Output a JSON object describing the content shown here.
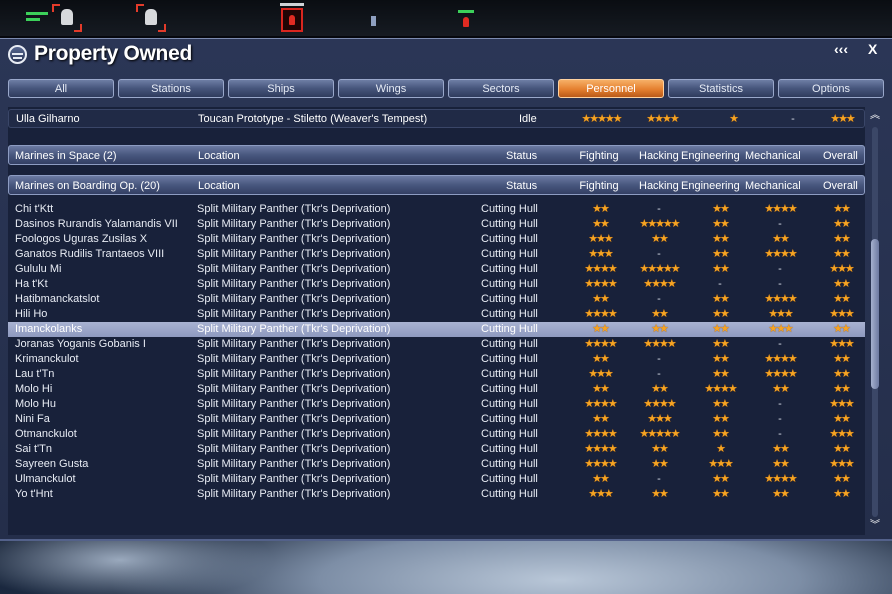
{
  "window": {
    "title": "Property Owned",
    "controls": {
      "collapse": "‹‹‹",
      "close": "X"
    }
  },
  "tabs": [
    {
      "label": "All",
      "active": false
    },
    {
      "label": "Stations",
      "active": false
    },
    {
      "label": "Ships",
      "active": false
    },
    {
      "label": "Wings",
      "active": false
    },
    {
      "label": "Sectors",
      "active": false
    },
    {
      "label": "Personnel",
      "active": true
    },
    {
      "label": "Statistics",
      "active": false
    },
    {
      "label": "Options",
      "active": false
    }
  ],
  "top_entry": {
    "name": "Ulla Gilharno",
    "location": "Toucan Prototype - Stiletto (Weaver's Tempest)",
    "status": "Idle",
    "fighting": "★★★★★",
    "hacking": "★★★★",
    "engineering": "★",
    "mechanical": "-",
    "overall": "★★★"
  },
  "groups": {
    "space": {
      "label": "Marines in Space (2)",
      "col_location": "Location",
      "col_status": "Status",
      "col_fighting": "Fighting",
      "col_hacking": "Hacking",
      "col_engineering": "Engineering",
      "col_mechanical": "Mechanical",
      "col_overall": "Overall"
    },
    "boarding": {
      "label": "Marines on Boarding Op. (20)",
      "col_location": "Location",
      "col_status": "Status",
      "col_fighting": "Fighting",
      "col_hacking": "Hacking",
      "col_engineering": "Engineering",
      "col_mechanical": "Mechanical",
      "col_overall": "Overall"
    }
  },
  "marines": [
    {
      "name": "Chi t'Ktt",
      "location": "Split Military Panther (Tkr's Deprivation)",
      "status": "Cutting Hull",
      "fighting": "★★",
      "hacking": "-",
      "engineering": "★★",
      "mechanical": "★★★★",
      "overall": "★★"
    },
    {
      "name": "Dasinos Rurandis Yalamandis VII",
      "location": "Split Military Panther (Tkr's Deprivation)",
      "status": "Cutting Hull",
      "fighting": "★★",
      "hacking": "★★★★★",
      "engineering": "★★",
      "mechanical": "-",
      "overall": "★★"
    },
    {
      "name": "Foologos Uguras Zusilas X",
      "location": "Split Military Panther (Tkr's Deprivation)",
      "status": "Cutting Hull",
      "fighting": "★★★",
      "hacking": "★★",
      "engineering": "★★",
      "mechanical": "★★",
      "overall": "★★"
    },
    {
      "name": "Ganatos Rudilis Trantaeos VIII",
      "location": "Split Military Panther (Tkr's Deprivation)",
      "status": "Cutting Hull",
      "fighting": "★★★",
      "hacking": "-",
      "engineering": "★★",
      "mechanical": "★★★★",
      "overall": "★★"
    },
    {
      "name": "Gululu Mi",
      "location": "Split Military Panther (Tkr's Deprivation)",
      "status": "Cutting Hull",
      "fighting": "★★★★",
      "hacking": "★★★★★",
      "engineering": "★★",
      "mechanical": "-",
      "overall": "★★★"
    },
    {
      "name": "Ha t'Kt",
      "location": "Split Military Panther (Tkr's Deprivation)",
      "status": "Cutting Hull",
      "fighting": "★★★★",
      "hacking": "★★★★",
      "engineering": "-",
      "mechanical": "-",
      "overall": "★★"
    },
    {
      "name": "Hatibmanckatslot",
      "location": "Split Military Panther (Tkr's Deprivation)",
      "status": "Cutting Hull",
      "fighting": "★★",
      "hacking": "-",
      "engineering": "★★",
      "mechanical": "★★★★",
      "overall": "★★"
    },
    {
      "name": "Hili Ho",
      "location": "Split Military Panther (Tkr's Deprivation)",
      "status": "Cutting Hull",
      "fighting": "★★★★",
      "hacking": "★★",
      "engineering": "★★",
      "mechanical": "★★★",
      "overall": "★★★"
    },
    {
      "name": "Imanckolanks",
      "location": "Split Military Panther (Tkr's Deprivation)",
      "status": "Cutting Hull",
      "fighting": "★★",
      "hacking": "★★",
      "engineering": "★★",
      "mechanical": "★★★",
      "overall": "★★",
      "selected": true
    },
    {
      "name": "Joranas Yoganis Gobanis I",
      "location": "Split Military Panther (Tkr's Deprivation)",
      "status": "Cutting Hull",
      "fighting": "★★★★",
      "hacking": "★★★★",
      "engineering": "★★",
      "mechanical": "-",
      "overall": "★★★"
    },
    {
      "name": "Krimanckulot",
      "location": "Split Military Panther (Tkr's Deprivation)",
      "status": "Cutting Hull",
      "fighting": "★★",
      "hacking": "-",
      "engineering": "★★",
      "mechanical": "★★★★",
      "overall": "★★"
    },
    {
      "name": "Lau t'Tn",
      "location": "Split Military Panther (Tkr's Deprivation)",
      "status": "Cutting Hull",
      "fighting": "★★★",
      "hacking": "-",
      "engineering": "★★",
      "mechanical": "★★★★",
      "overall": "★★"
    },
    {
      "name": "Molo Hi",
      "location": "Split Military Panther (Tkr's Deprivation)",
      "status": "Cutting Hull",
      "fighting": "★★",
      "hacking": "★★",
      "engineering": "★★★★",
      "mechanical": "★★",
      "overall": "★★"
    },
    {
      "name": "Molo Hu",
      "location": "Split Military Panther (Tkr's Deprivation)",
      "status": "Cutting Hull",
      "fighting": "★★★★",
      "hacking": "★★★★",
      "engineering": "★★",
      "mechanical": "-",
      "overall": "★★★"
    },
    {
      "name": "Nini Fa",
      "location": "Split Military Panther (Tkr's Deprivation)",
      "status": "Cutting Hull",
      "fighting": "★★",
      "hacking": "★★★",
      "engineering": "★★",
      "mechanical": "-",
      "overall": "★★"
    },
    {
      "name": "Otmanckulot",
      "location": "Split Military Panther (Tkr's Deprivation)",
      "status": "Cutting Hull",
      "fighting": "★★★★",
      "hacking": "★★★★★",
      "engineering": "★★",
      "mechanical": "-",
      "overall": "★★★"
    },
    {
      "name": "Sai t'Tn",
      "location": "Split Military Panther (Tkr's Deprivation)",
      "status": "Cutting Hull",
      "fighting": "★★★★",
      "hacking": "★★",
      "engineering": "★",
      "mechanical": "★★",
      "overall": "★★"
    },
    {
      "name": "Sayreen Gusta",
      "location": "Split Military Panther (Tkr's Deprivation)",
      "status": "Cutting Hull",
      "fighting": "★★★★",
      "hacking": "★★",
      "engineering": "★★★",
      "mechanical": "★★",
      "overall": "★★★"
    },
    {
      "name": "Ulmanckulot",
      "location": "Split Military Panther (Tkr's Deprivation)",
      "status": "Cutting Hull",
      "fighting": "★★",
      "hacking": "-",
      "engineering": "★★",
      "mechanical": "★★★★",
      "overall": "★★"
    },
    {
      "name": "Yo t'Hnt",
      "location": "Split Military Panther (Tkr's Deprivation)",
      "status": "Cutting Hull",
      "fighting": "★★★",
      "hacking": "★★",
      "engineering": "★★",
      "mechanical": "★★",
      "overall": "★★"
    }
  ],
  "colors": {
    "accent_active_tab": "#e5802f",
    "star": "#f6a423",
    "selection": "#9aa4c8",
    "panel": "#18213a"
  },
  "icons": {
    "title": "property-globe-icon",
    "scroll_up": "scroll-up-icon",
    "scroll_down": "scroll-down-icon"
  }
}
